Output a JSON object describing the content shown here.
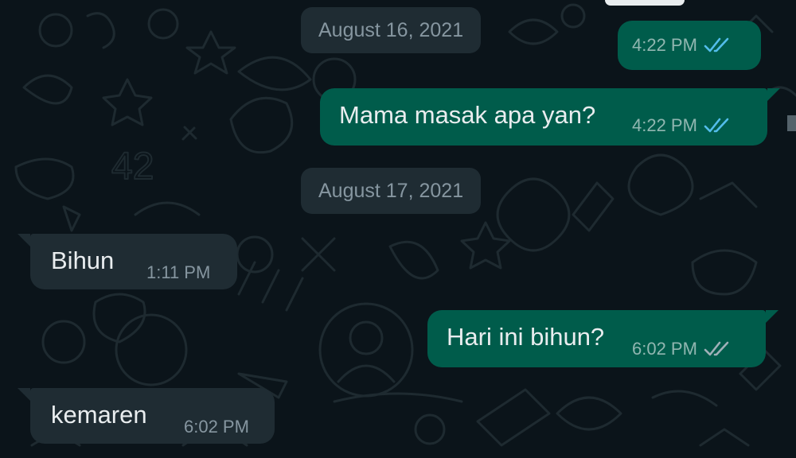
{
  "theme": {
    "background": "#0b141a",
    "outgoing_bubble": "#005c4b",
    "incoming_bubble": "#1f2c33",
    "read_tick_color": "#53bdeb",
    "delivered_tick_color": "#9fb0b8"
  },
  "dates": [
    {
      "label": "August 16, 2021"
    },
    {
      "label": "August 17, 2021"
    }
  ],
  "messages": [
    {
      "direction": "out",
      "text": "",
      "time": "4:22 PM",
      "status": "read-ticks-icon"
    },
    {
      "direction": "out",
      "text": "Mama masak apa yan?",
      "time": "4:22 PM",
      "status": "read-ticks-icon"
    },
    {
      "direction": "in",
      "text": "Bihun",
      "time": "1:11 PM"
    },
    {
      "direction": "out",
      "text": "Hari ini bihun?",
      "time": "6:02 PM",
      "status": "delivered-ticks-icon"
    },
    {
      "direction": "in",
      "text": "kemaren",
      "time": "6:02 PM"
    }
  ]
}
